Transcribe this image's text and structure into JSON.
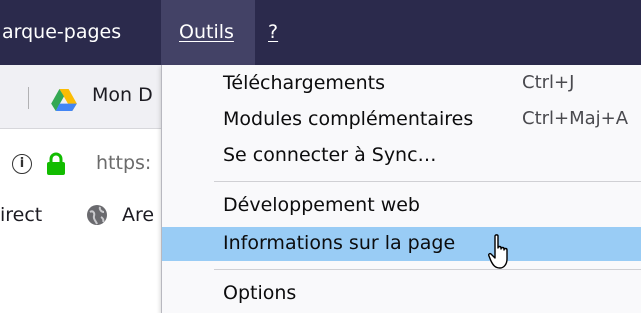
{
  "menubar": {
    "items": [
      {
        "label": "arque-pages"
      },
      {
        "label": "Outils"
      },
      {
        "label": "?"
      }
    ]
  },
  "toolbar": {
    "bookmark_label": "Mon D"
  },
  "urlbar": {
    "url": "https:"
  },
  "bookmarks_strip": {
    "items": [
      {
        "label": "irect"
      },
      {
        "label": "Are"
      }
    ]
  },
  "tools_menu": {
    "items": [
      {
        "label": "Téléchargements",
        "shortcut": "Ctrl+J"
      },
      {
        "label": "Modules complémentaires",
        "shortcut": "Ctrl+Maj+A"
      },
      {
        "label": "Se connecter à Sync…",
        "shortcut": ""
      },
      {
        "label": "Développement web",
        "shortcut": ""
      },
      {
        "label": "Informations sur la page",
        "shortcut": ""
      },
      {
        "label": "Options",
        "shortcut": ""
      }
    ]
  },
  "colors": {
    "menubar_bg": "#2b2a4c",
    "active_menu_bg": "#434266",
    "highlight": "#99ccf5",
    "lock_green": "#12bc00"
  }
}
